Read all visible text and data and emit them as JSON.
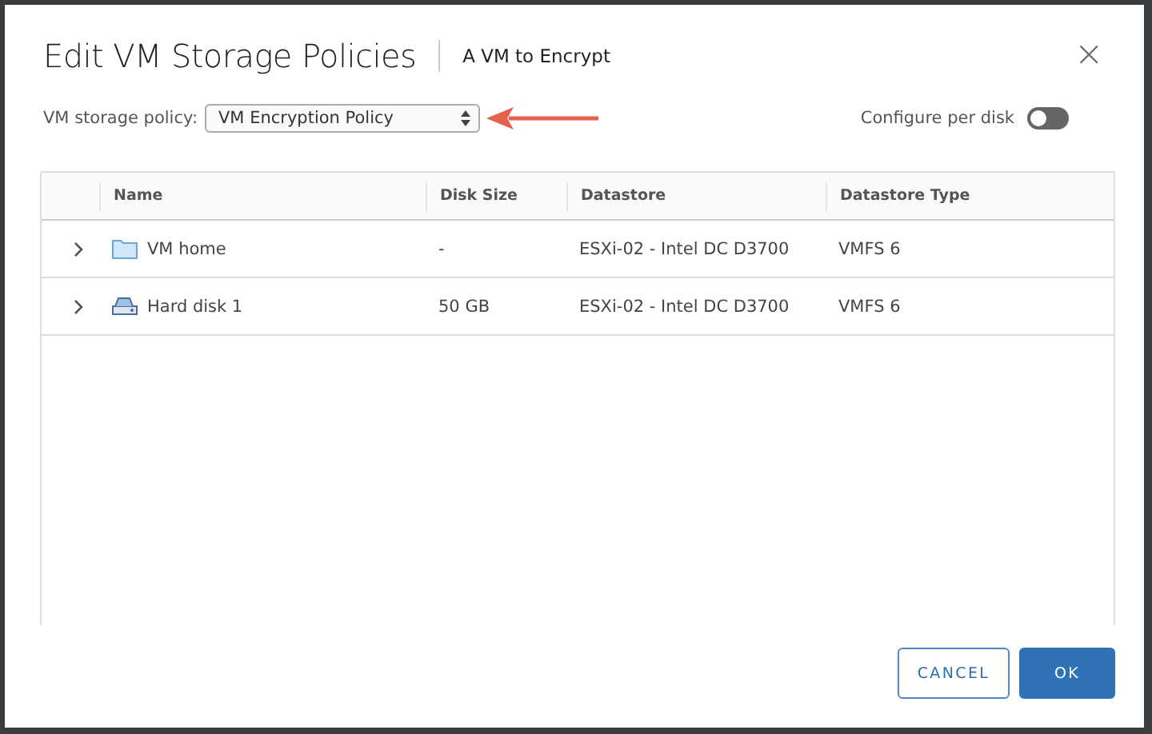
{
  "dialog": {
    "title": "Edit VM Storage Policies",
    "subtitle": "A VM to Encrypt",
    "close_icon": "×"
  },
  "policy": {
    "label": "VM storage policy:",
    "value": "VM Encryption Policy"
  },
  "configure_per_disk": {
    "label": "Configure per disk",
    "on": false
  },
  "table": {
    "columns": [
      "Name",
      "Disk Size",
      "Datastore",
      "Datastore Type"
    ],
    "rows": [
      {
        "kind": "folder",
        "expanded": false,
        "cells": [
          "VM home",
          "-",
          "ESXi-02 - Intel DC D3700",
          "VMFS 6"
        ]
      },
      {
        "kind": "disk",
        "expanded": false,
        "cells": [
          "Hard disk 1",
          "50 GB",
          "ESXi-02 - Intel DC D3700",
          "VMFS 6"
        ]
      }
    ]
  },
  "buttons": [
    {
      "kind": "secondary",
      "label": "CANCEL"
    },
    {
      "kind": "primary",
      "label": "OK"
    }
  ]
}
